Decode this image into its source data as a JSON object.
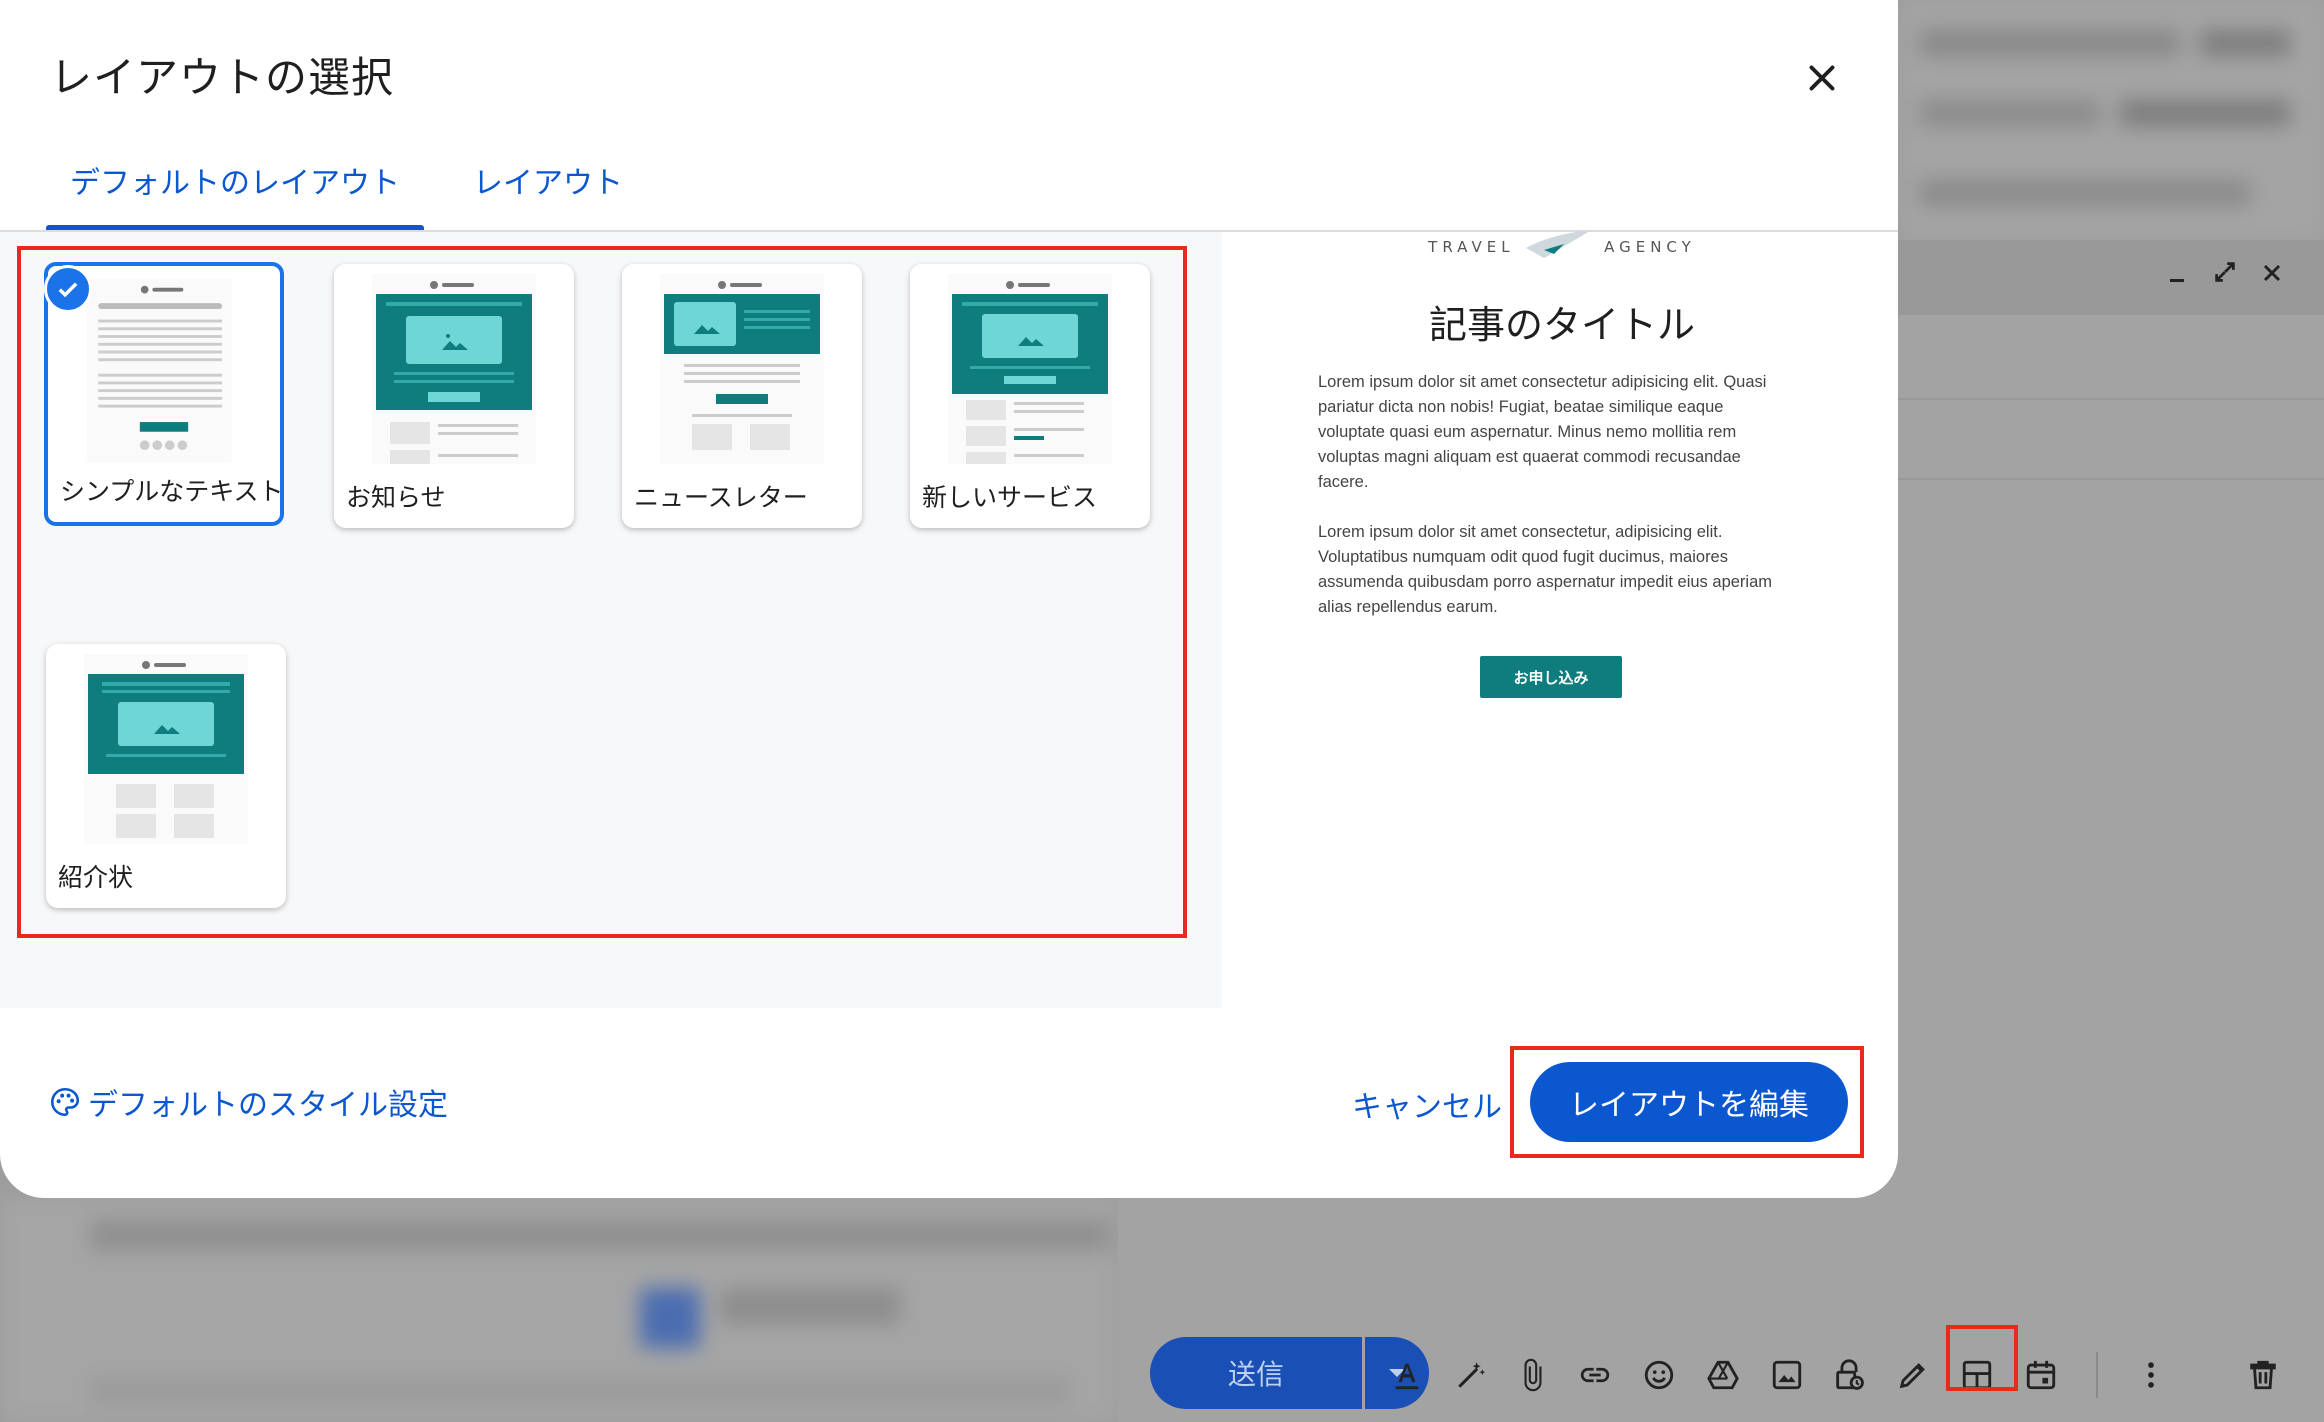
{
  "dialog": {
    "title": "レイアウトの選択",
    "close_icon": "close-icon",
    "tabs": [
      {
        "label": "デフォルトのレイアウト",
        "active": true
      },
      {
        "label": "レイアウト",
        "active": false
      }
    ],
    "layouts": [
      {
        "label": "シンプルなテキスト",
        "selected": true
      },
      {
        "label": "お知らせ",
        "selected": false
      },
      {
        "label": "ニュースレター",
        "selected": false
      },
      {
        "label": "新しいサービス",
        "selected": false
      },
      {
        "label": "紹介状",
        "selected": false
      }
    ],
    "preview": {
      "logo_left": "TRAVEL",
      "logo_right": "AGENCY",
      "title": "記事のタイトル",
      "paragraph1": "Lorem ipsum dolor sit amet consectetur adipisicing elit. Quasi pariatur dicta non nobis! Fugiat, beatae similique eaque voluptate quasi eum aspernatur. Minus nemo mollitia rem voluptas magni aliquam est quaerat commodi recusandae facere.",
      "paragraph2": "Lorem ipsum dolor sit amet consectetur, adipisicing elit. Voluptatibus numquam odit quod fugit ducimus, maiores assumenda quibusdam porro aspernatur impedit eius aperiam alias repellendus earum.",
      "button": "お申し込み"
    },
    "footer": {
      "style_link": "デフォルトのスタイル設定",
      "cancel": "キャンセル",
      "edit": "レイアウトを編集"
    }
  },
  "compose": {
    "send": "送信"
  },
  "colors": {
    "accent": "#0b57d0",
    "highlight": "#e8291b",
    "teal": "#0f7d7d",
    "teal_light": "#6fd6d6"
  }
}
